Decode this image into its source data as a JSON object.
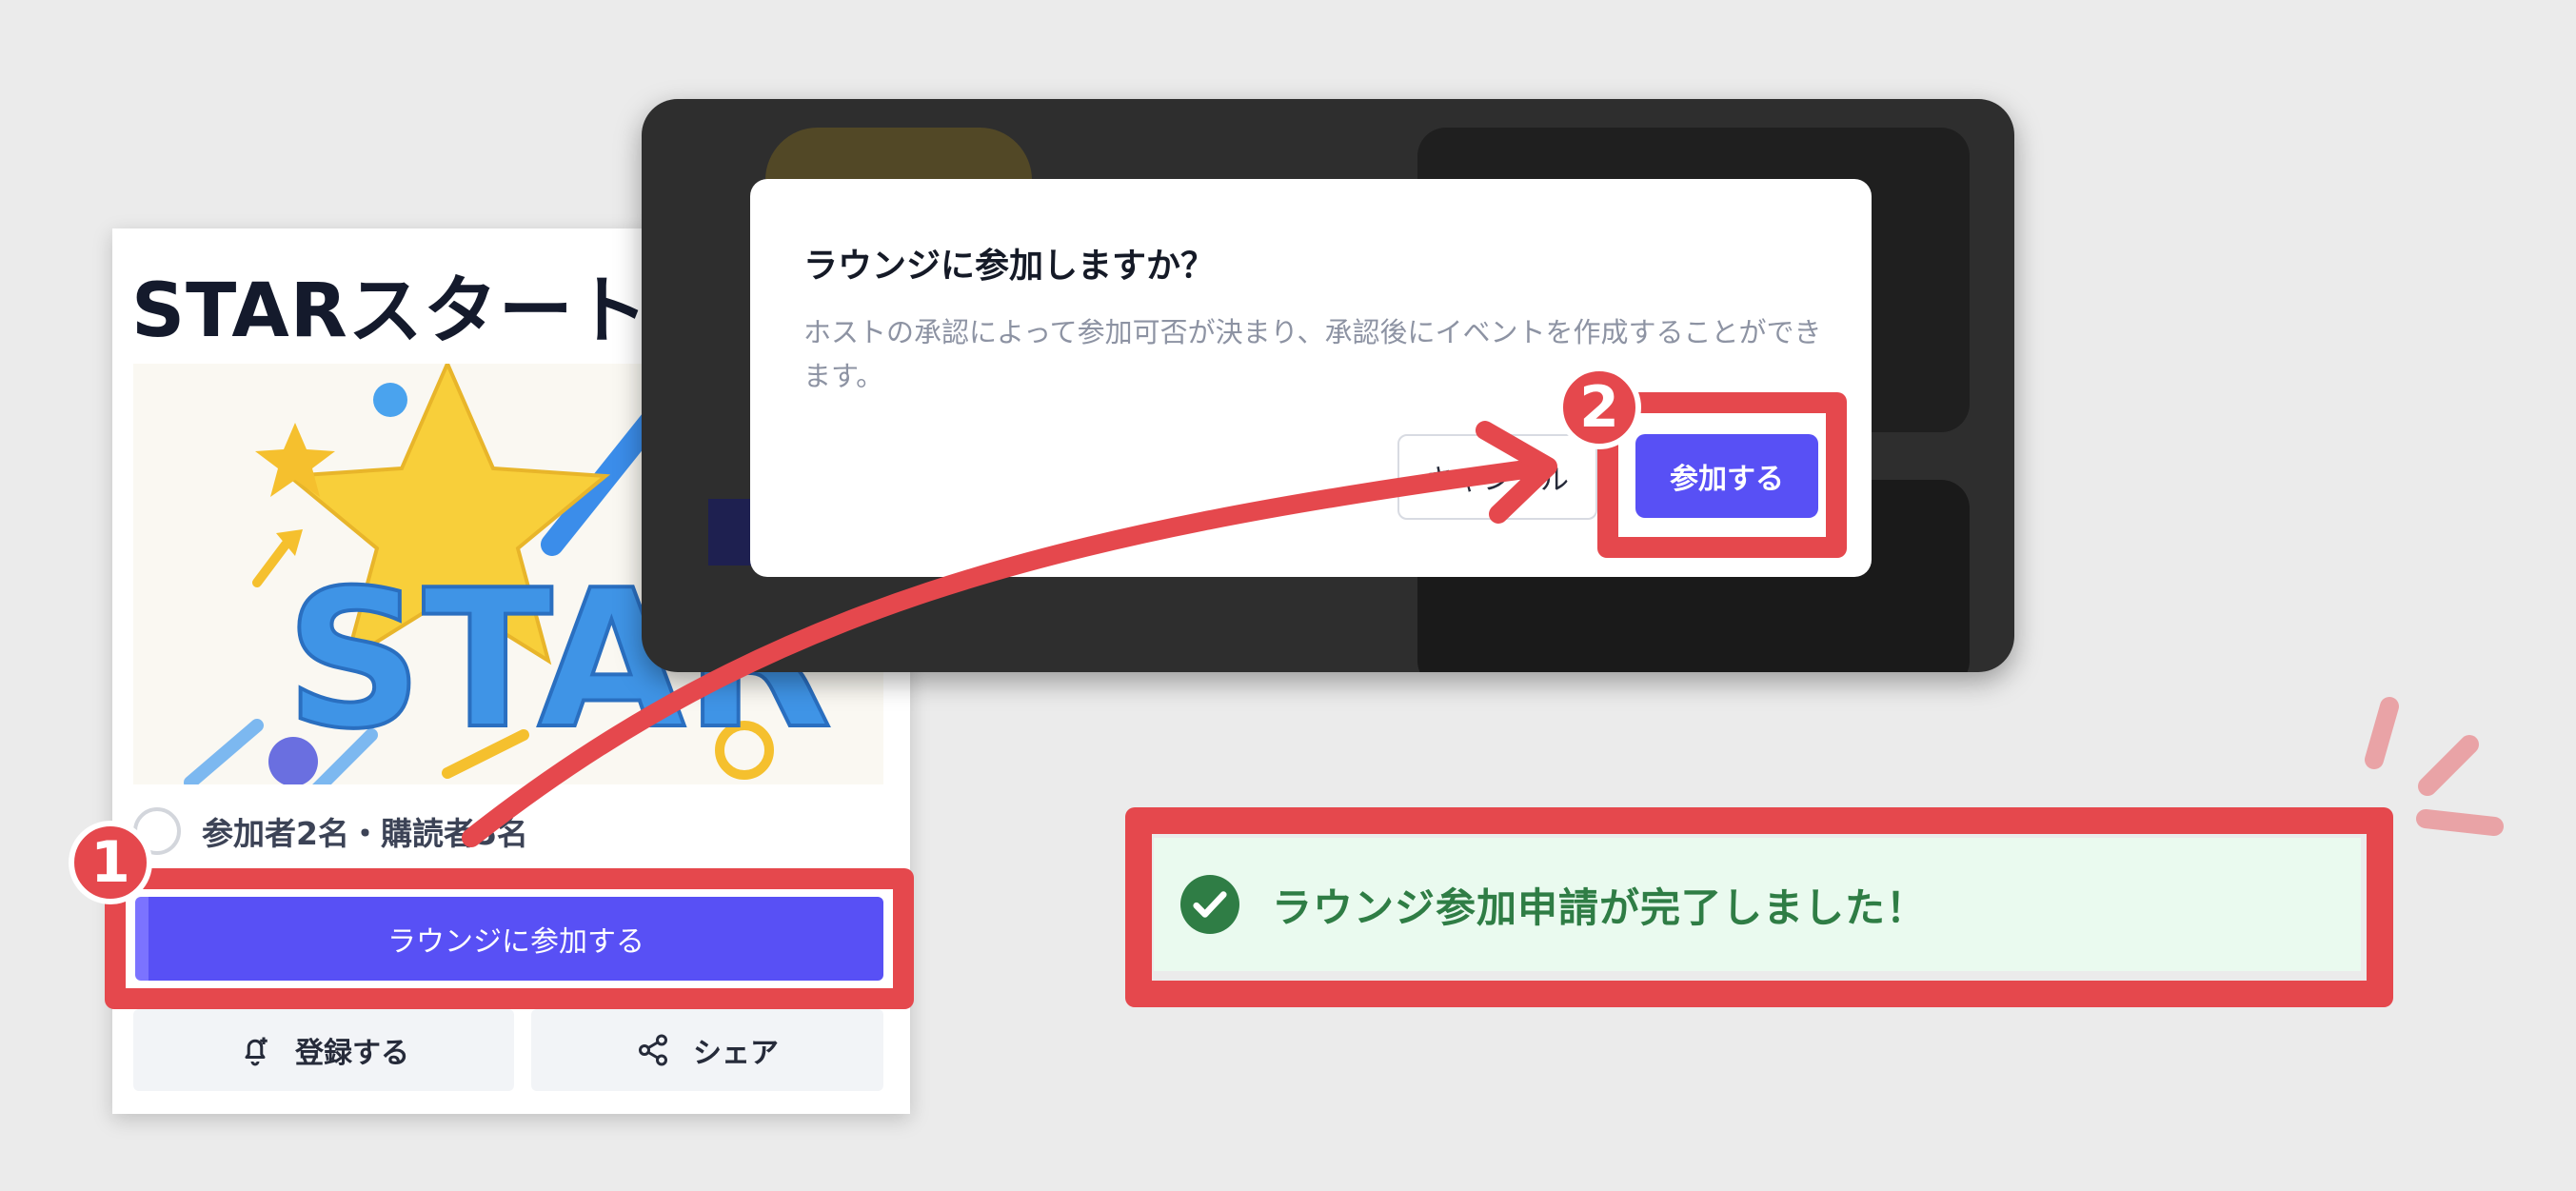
{
  "card": {
    "title": "STARスタートア",
    "hero_text": "STAR",
    "stats": "参加者2名・購読者5名",
    "join_label": "ラウンジに参加する",
    "subscribe_label": "登録する",
    "share_label": "シェア"
  },
  "dialog": {
    "title": "ラウンジに参加しますか？",
    "body": "ホストの承認によって参加可否が決まり、承認後にイベントを作成することができます。",
    "cancel_label": "キャンセル",
    "confirm_label": "参加する"
  },
  "toast": {
    "message": "ラウンジ参加申請が完了しました！"
  },
  "annotations": {
    "step1": "1",
    "step2": "2"
  },
  "colors": {
    "accent": "#5850f5",
    "highlight": "#e5484d",
    "success_bg": "#eafaef",
    "success_text": "#2f7d45"
  },
  "icons": [
    "bell-plus-icon",
    "share-icon",
    "check-circle-icon",
    "arrow-icon"
  ]
}
